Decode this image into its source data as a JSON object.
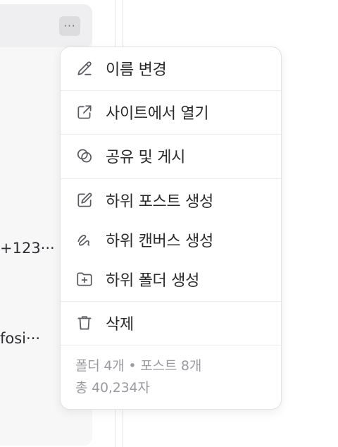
{
  "background": {
    "more_button_label": "···",
    "fragments": [
      "+123···",
      "fosi···"
    ]
  },
  "menu": {
    "items": [
      {
        "label": "이름 변경",
        "icon": "pencil-icon"
      },
      {
        "label": "사이트에서 열기",
        "icon": "external-link-icon"
      },
      {
        "label": "공유 및 게시",
        "icon": "share-circles-icon"
      },
      {
        "label": "하위 포스트 생성",
        "icon": "edit-square-icon"
      },
      {
        "label": "하위 캔버스 생성",
        "icon": "squiggle-icon"
      },
      {
        "label": "하위 폴더 생성",
        "icon": "folder-plus-icon"
      },
      {
        "label": "삭제",
        "icon": "trash-icon"
      }
    ],
    "stats": {
      "line1": "폴더 4개 • 포스트 8개",
      "line2": "총 40,234자"
    }
  }
}
